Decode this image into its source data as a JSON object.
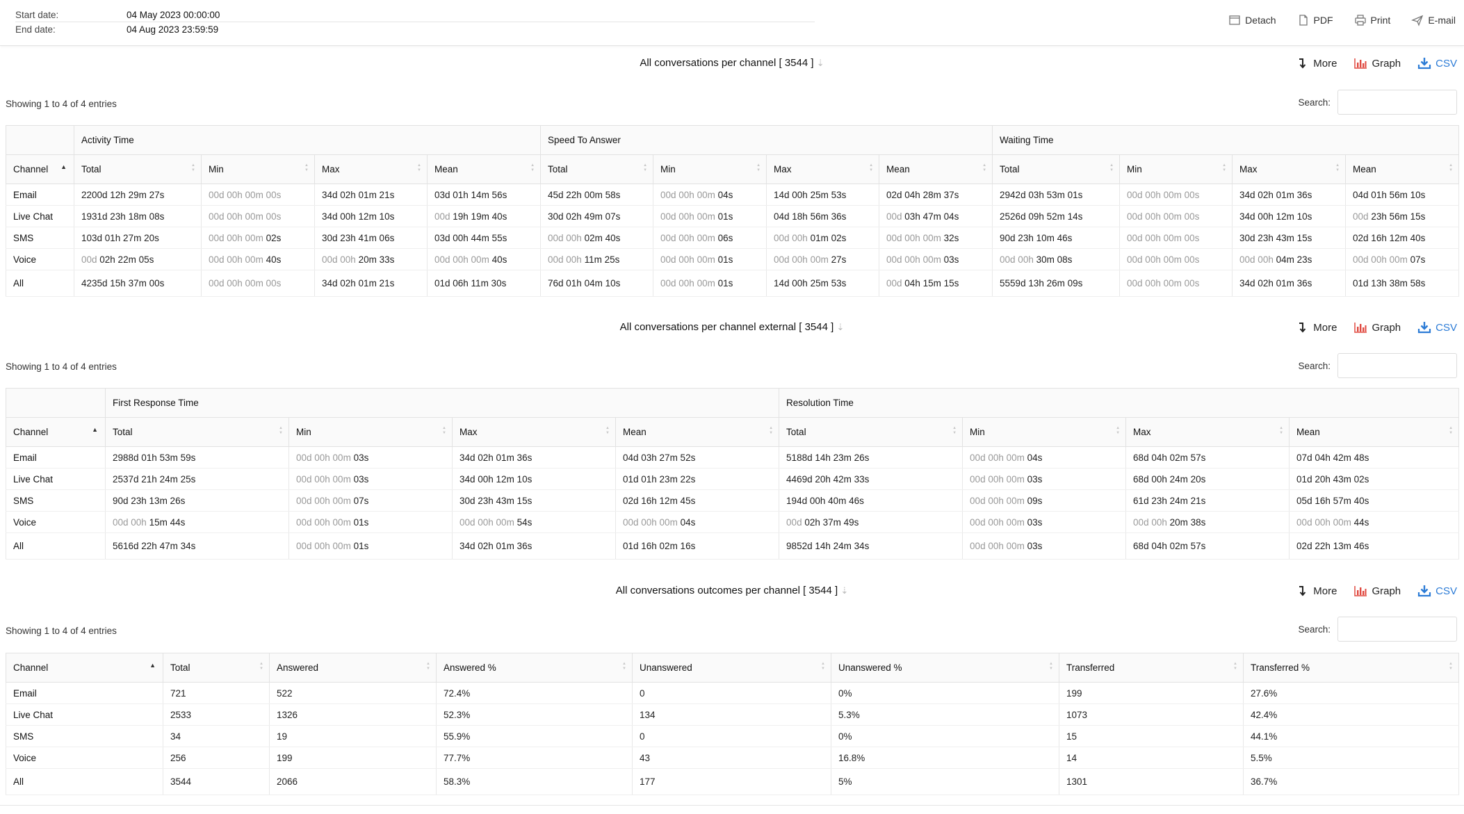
{
  "header": {
    "start_label": "Start date:",
    "start_value": "04 May 2023 00:00:00",
    "end_label": "End date:",
    "end_value": "04 Aug 2023 23:59:59",
    "actions": {
      "detach": "Detach",
      "pdf": "PDF",
      "print": "Print",
      "email": "E-mail"
    }
  },
  "common": {
    "more": "More",
    "graph": "Graph",
    "csv": "CSV",
    "search_label": "Search:",
    "showing": "Showing 1 to 4 of 4 entries",
    "sort_arrow": "⇣"
  },
  "colors": {
    "accent": "#2b7bd6",
    "graph_red": "#e0483f",
    "muted_text": "#999999"
  },
  "section1": {
    "title": "All conversations per channel [ 3544 ]",
    "groups": [
      "Activity Time",
      "Speed To Answer",
      "Waiting Time"
    ],
    "channel_header": "Channel",
    "sub_headers": [
      "Total",
      "Min",
      "Max",
      "Mean"
    ],
    "rows": [
      [
        "Email",
        "2200d 12h 29m 27s",
        "00d 00h 00m 00s",
        "34d 02h 01m 21s",
        "03d 01h 14m 56s",
        "45d 22h 00m 58s",
        "00d 00h 00m 04s",
        "14d 00h 25m 53s",
        "02d 04h 28m 37s",
        "2942d 03h 53m 01s",
        "00d 00h 00m 00s",
        "34d 02h 01m 36s",
        "04d 01h 56m 10s"
      ],
      [
        "Live Chat",
        "1931d 23h 18m 08s",
        "00d 00h 00m 00s",
        "34d 00h 12m 10s",
        "00d 19h 19m 40s",
        "30d 02h 49m 07s",
        "00d 00h 00m 01s",
        "04d 18h 56m 36s",
        "00d 03h 47m 04s",
        "2526d 09h 52m 14s",
        "00d 00h 00m 00s",
        "34d 00h 12m 10s",
        "00d 23h 56m 15s"
      ],
      [
        "SMS",
        "103d 01h 27m 20s",
        "00d 00h 00m 02s",
        "30d 23h 41m 06s",
        "03d 00h 44m 55s",
        "00d 00h 02m 40s",
        "00d 00h 00m 06s",
        "00d 00h 01m 02s",
        "00d 00h 00m 32s",
        "90d 23h 10m 46s",
        "00d 00h 00m 00s",
        "30d 23h 43m 15s",
        "02d 16h 12m 40s"
      ],
      [
        "Voice",
        "00d 02h 22m 05s",
        "00d 00h 00m 40s",
        "00d 00h 20m 33s",
        "00d 00h 00m 40s",
        "00d 00h 11m 25s",
        "00d 00h 00m 01s",
        "00d 00h 00m 27s",
        "00d 00h 00m 03s",
        "00d 00h 30m 08s",
        "00d 00h 00m 00s",
        "00d 00h 04m 23s",
        "00d 00h 00m 07s"
      ]
    ],
    "total": [
      "All",
      "4235d 15h 37m 00s",
      "00d 00h 00m 00s",
      "34d 02h 01m 21s",
      "01d 06h 11m 30s",
      "76d 01h 04m 10s",
      "00d 00h 00m 01s",
      "14d 00h 25m 53s",
      "00d 04h 15m 15s",
      "5559d 13h 26m 09s",
      "00d 00h 00m 00s",
      "34d 02h 01m 36s",
      "01d 13h 38m 58s"
    ]
  },
  "section2": {
    "title": "All conversations per channel external [ 3544 ]",
    "groups": [
      "First Response Time",
      "Resolution Time"
    ],
    "channel_header": "Channel",
    "sub_headers": [
      "Total",
      "Min",
      "Max",
      "Mean"
    ],
    "rows": [
      [
        "Email",
        "2988d 01h 53m 59s",
        "00d 00h 00m 03s",
        "34d 02h 01m 36s",
        "04d 03h 27m 52s",
        "5188d 14h 23m 26s",
        "00d 00h 00m 04s",
        "68d 04h 02m 57s",
        "07d 04h 42m 48s"
      ],
      [
        "Live Chat",
        "2537d 21h 24m 25s",
        "00d 00h 00m 03s",
        "34d 00h 12m 10s",
        "01d 01h 23m 22s",
        "4469d 20h 42m 33s",
        "00d 00h 00m 03s",
        "68d 00h 24m 20s",
        "01d 20h 43m 02s"
      ],
      [
        "SMS",
        "90d 23h 13m 26s",
        "00d 00h 00m 07s",
        "30d 23h 43m 15s",
        "02d 16h 12m 45s",
        "194d 00h 40m 46s",
        "00d 00h 00m 09s",
        "61d 23h 24m 21s",
        "05d 16h 57m 40s"
      ],
      [
        "Voice",
        "00d 00h 15m 44s",
        "00d 00h 00m 01s",
        "00d 00h 00m 54s",
        "00d 00h 00m 04s",
        "00d 02h 37m 49s",
        "00d 00h 00m 03s",
        "00d 00h 20m 38s",
        "00d 00h 00m 44s"
      ]
    ],
    "total": [
      "All",
      "5616d 22h 47m 34s",
      "00d 00h 00m 01s",
      "34d 02h 01m 36s",
      "01d 16h 02m 16s",
      "9852d 14h 24m 34s",
      "00d 00h 00m 03s",
      "68d 04h 02m 57s",
      "02d 22h 13m 46s"
    ]
  },
  "section3": {
    "title": "All conversations outcomes per channel [ 3544 ]",
    "headers": [
      "Channel",
      "Total",
      "Answered",
      "Answered %",
      "Unanswered",
      "Unanswered %",
      "Transferred",
      "Transferred %"
    ],
    "rows": [
      [
        "Email",
        "721",
        "522",
        "72.4%",
        "0",
        "0%",
        "199",
        "27.6%"
      ],
      [
        "Live Chat",
        "2533",
        "1326",
        "52.3%",
        "134",
        "5.3%",
        "1073",
        "42.4%"
      ],
      [
        "SMS",
        "34",
        "19",
        "55.9%",
        "0",
        "0%",
        "15",
        "44.1%"
      ],
      [
        "Voice",
        "256",
        "199",
        "77.7%",
        "43",
        "16.8%",
        "14",
        "5.5%"
      ]
    ],
    "total": [
      "All",
      "3544",
      "2066",
      "58.3%",
      "177",
      "5%",
      "1301",
      "36.7%"
    ]
  }
}
